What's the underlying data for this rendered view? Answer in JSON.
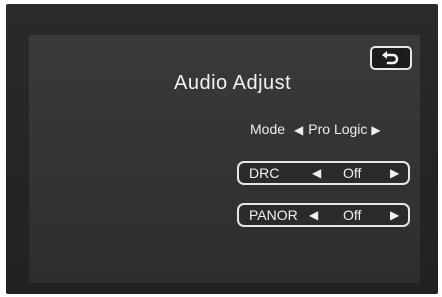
{
  "menu": {
    "title": "Audio Adjust",
    "back_icon": "return-arrow-icon"
  },
  "mode": {
    "label": "Mode",
    "value": "Pro Logic",
    "left_arrow": "◀",
    "right_arrow": "▶"
  },
  "options": [
    {
      "label": "DRC",
      "value": "Off",
      "left_arrow": "◀",
      "right_arrow": "▶"
    },
    {
      "label": "PANOR",
      "value": "Off",
      "left_arrow": "◀",
      "right_arrow": "▶"
    }
  ],
  "colors": {
    "background": "#2a2a2a",
    "panel": "#353535",
    "text": "#f0f0f0",
    "outline": "#e6e6e6"
  }
}
